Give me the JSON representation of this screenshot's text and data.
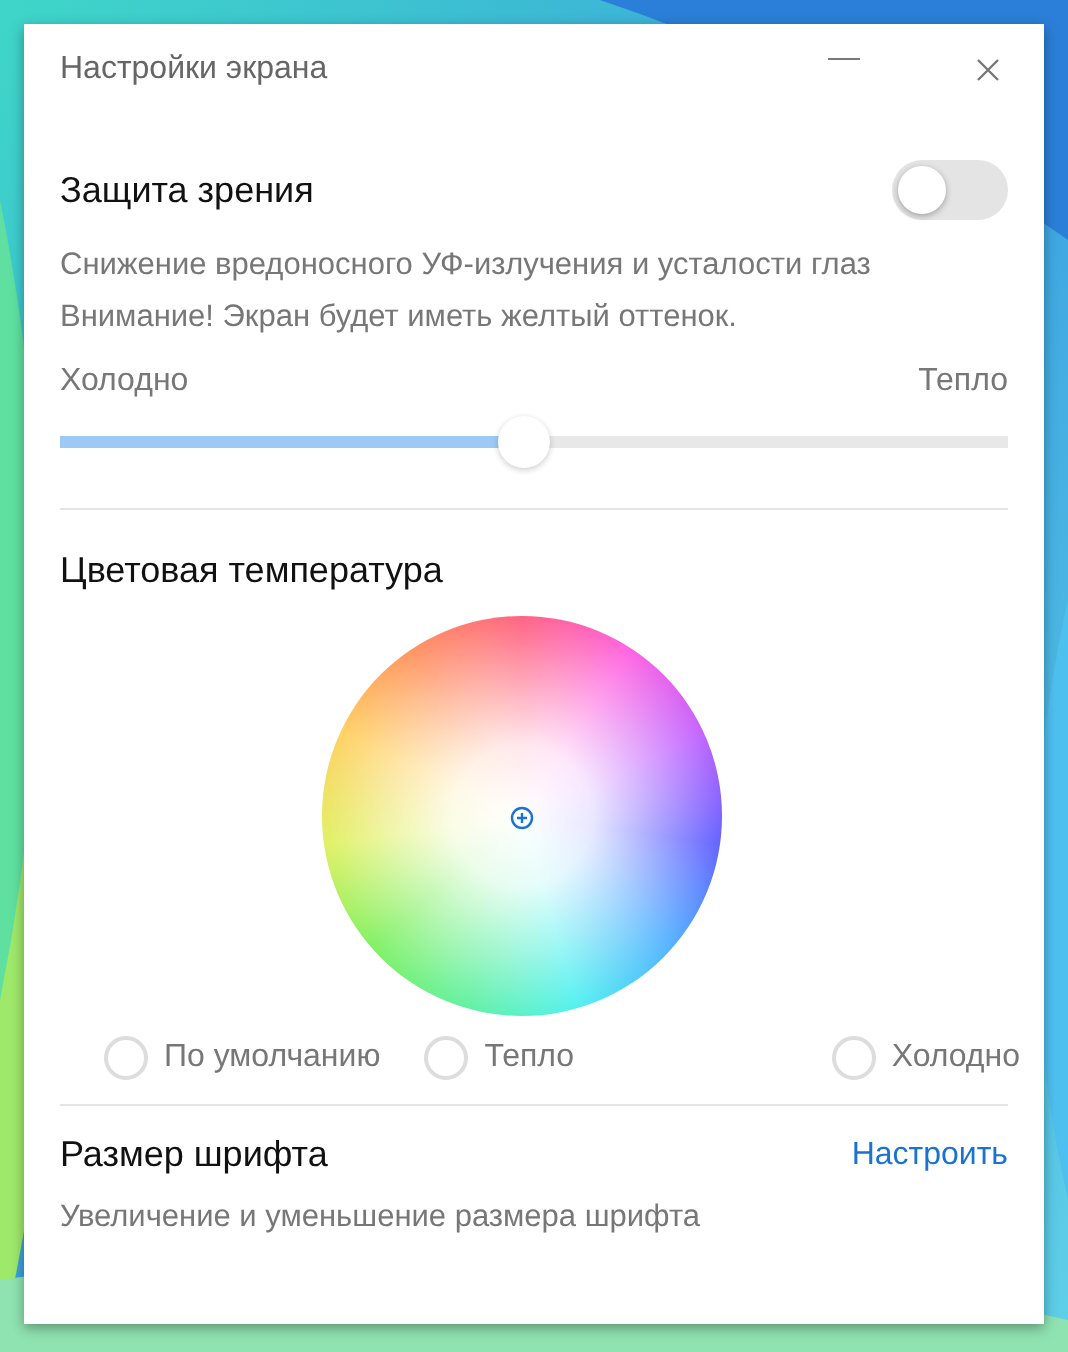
{
  "window": {
    "title": "Настройки экрана"
  },
  "eye_protection": {
    "title": "Защита зрения",
    "on": false,
    "description": [
      "Снижение вредоносного УФ-излучения и усталости глаз",
      "Внимание! Экран будет иметь желтый оттенок."
    ],
    "slider": {
      "min_label": "Холодно",
      "max_label": "Тепло",
      "level": 0.49
    }
  },
  "color_temperature": {
    "title": "Цветовая температура",
    "options": [
      {
        "label": "По умолчанию",
        "selected": false
      },
      {
        "label": "Тепло",
        "selected": false
      },
      {
        "label": "Холодно",
        "selected": false
      }
    ]
  },
  "font_size": {
    "title": "Размер шрифта",
    "link": "Настроить",
    "description": "Увеличение и уменьшение размера шрифта"
  }
}
